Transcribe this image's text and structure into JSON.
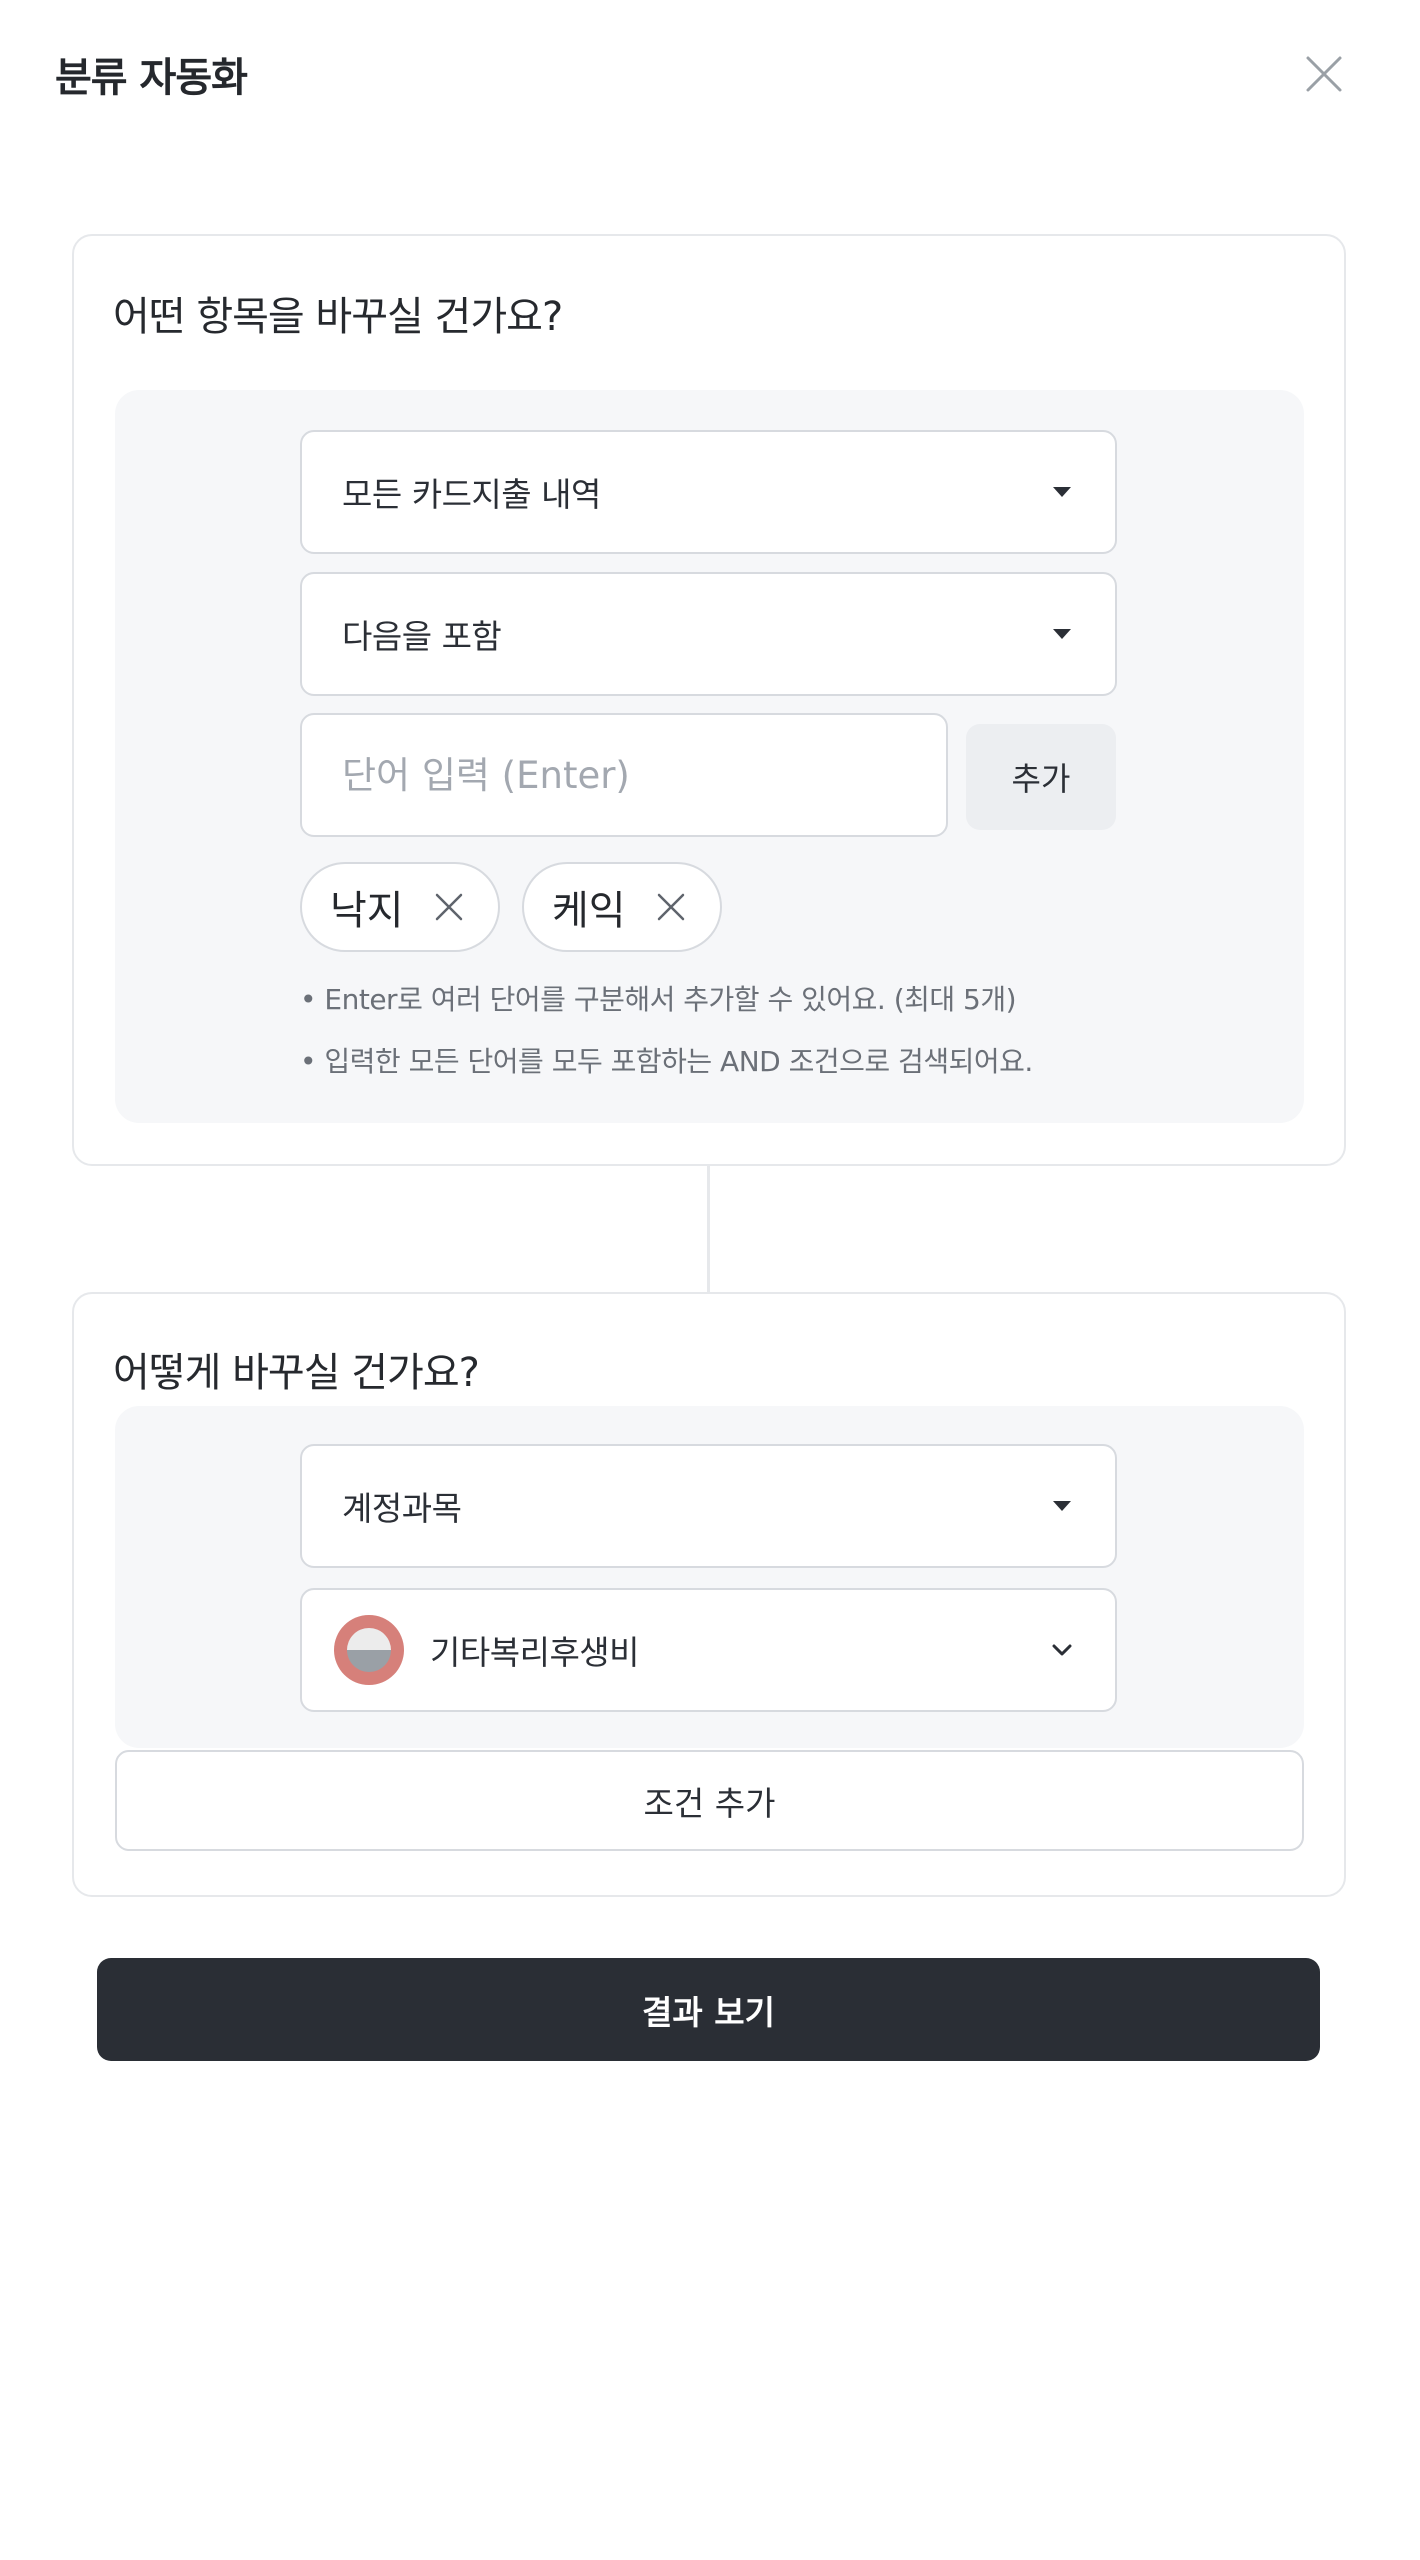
{
  "header": {
    "title": "분류 자동화",
    "close_icon": "close-icon"
  },
  "section_what": {
    "title": "어떤 항목을 바꾸실 건가요?",
    "target_select": {
      "value": "모든 카드지출 내역"
    },
    "condition_select": {
      "value": "다음을 포함"
    },
    "word_input": {
      "value": "",
      "placeholder": "단어 입력 (Enter)"
    },
    "add_button": "추가",
    "chips": [
      {
        "label": "낙지",
        "remove_icon": "close-icon"
      },
      {
        "label": "케익",
        "remove_icon": "close-icon"
      }
    ],
    "notes": [
      "• Enter로 여러 단어를 구분해서 추가할 수 있어요. (최대 5개)",
      "• 입력한 모든 단어를 모두 포함하는 AND 조건으로 검색되어요."
    ]
  },
  "section_how": {
    "title": "어떻게 바꾸실 건가요?",
    "field_select": {
      "value": "계정과목"
    },
    "category_select": {
      "value": "기타복리후생비",
      "icon": "category-badge-icon"
    },
    "add_condition_button": "조건 추가"
  },
  "footer": {
    "result_button": "결과 보기"
  },
  "colors": {
    "primary_button": "#2a2e35",
    "panel_bg": "#f6f7f9",
    "border": "#d7dadf",
    "badge": "#d6807a"
  }
}
